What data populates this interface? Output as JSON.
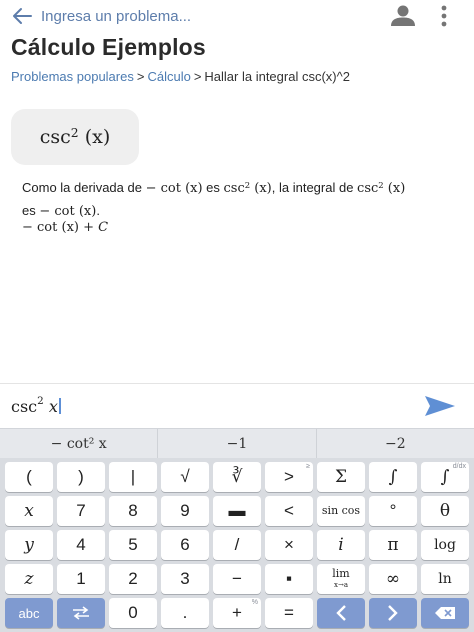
{
  "header": {
    "search_text": "Ingresa un problema...",
    "back_icon": "arrow-left-icon",
    "user_icon": "user-icon",
    "more_icon": "more-vertical-icon"
  },
  "page": {
    "title": "Cálculo Ejemplos"
  },
  "breadcrumb": {
    "items": [
      "Problemas populares",
      "Cálculo",
      "Hallar la integral csc(x)^2"
    ],
    "separator": ">"
  },
  "problem": {
    "fn": "csc",
    "power": "2",
    "arg": "(x)"
  },
  "solution": {
    "line1_a": "Como la derivada de ",
    "line1_b": " es ",
    "line1_c": ", la integral de ",
    "line2_a": "es ",
    "line2_b": ".",
    "neg_cot": "− cot ",
    "csc": "csc",
    "power": "2",
    "x_paren": "(x)",
    "result_a": "− cot ",
    "result_b": "(x)",
    "result_c": " + ",
    "result_const": "C"
  },
  "input": {
    "fn": "csc",
    "power": "2",
    "var": "x",
    "send_icon": "send-icon"
  },
  "suggestions": [
    "− cot² x",
    "−1",
    "−2"
  ],
  "keyboard": {
    "row1": [
      "(",
      ")",
      "|",
      "√",
      "∛",
      ">",
      "Σ",
      "∫",
      "∫"
    ],
    "row1_corners": [
      "",
      "",
      "",
      "",
      "",
      "≥",
      "",
      "",
      "d/dx"
    ],
    "row2": [
      "x",
      "7",
      "8",
      "9",
      "▬",
      "<",
      "sin cos",
      "°",
      "θ"
    ],
    "row3": [
      "y",
      "4",
      "5",
      "6",
      "/",
      "×",
      "i",
      "π",
      "log"
    ],
    "row4": [
      "z",
      "1",
      "2",
      "3",
      "−",
      "▪",
      "lim",
      "∞",
      "ln"
    ],
    "row5_abc": "abc",
    "row5": [
      "0",
      ".",
      "+",
      "="
    ],
    "row5_corners": [
      "",
      "",
      "%",
      ""
    ],
    "lim_sub": "x→a",
    "icons": {
      "swap": "swap-icon",
      "left": "arrow-left-key-icon",
      "right": "arrow-right-key-icon",
      "backspace": "backspace-icon"
    }
  }
}
